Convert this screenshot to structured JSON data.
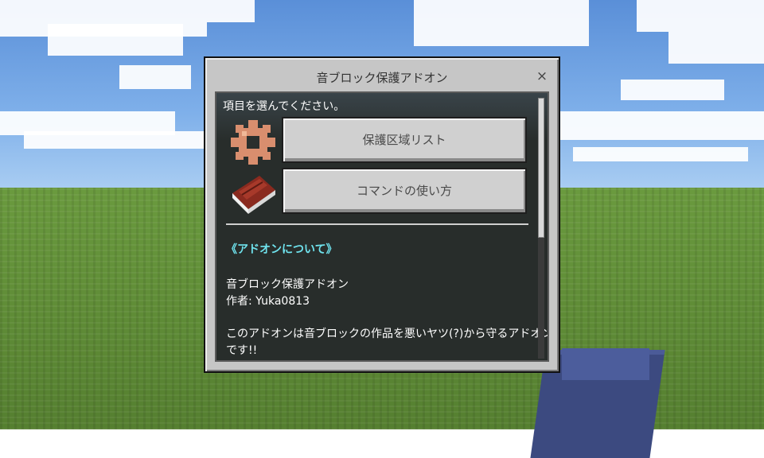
{
  "dialog": {
    "title": "音ブロック保護アドオン",
    "close_glyph": "×"
  },
  "menu": {
    "prompt": "項目を選んでください。",
    "buttons": [
      {
        "label": "保護区域リスト",
        "icon": "gear-icon"
      },
      {
        "label": "コマンドの使い方",
        "icon": "book-icon"
      }
    ]
  },
  "about": {
    "heading": "《アドオンについて》",
    "name_line": "音ブロック保護アドオン",
    "author_line": "作者: Yuka0813",
    "description_line1": "このアドオンは音ブロックの作品を悪いヤツ(?)から守るアドオン",
    "description_line2": "です!!"
  },
  "colors": {
    "accent_heading": "#6fe3ee",
    "panel_background": "#1b211f",
    "button_face": "#d0d0d0",
    "dialog_face": "#c6c6c6"
  }
}
